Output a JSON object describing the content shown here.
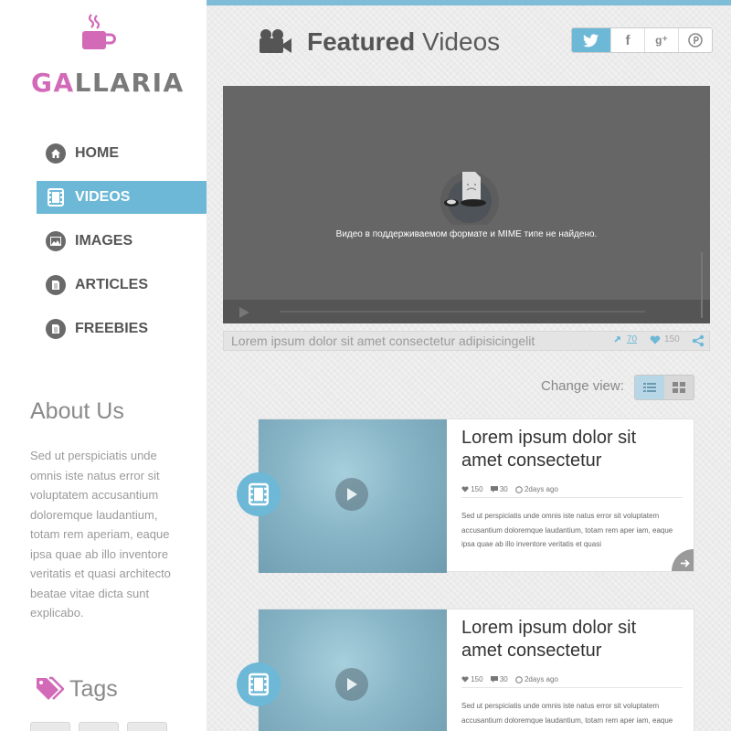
{
  "brand": {
    "logo_accent": "GA",
    "logo_rest": "LLARIA",
    "accent_color": "#d26ab8",
    "primary_color": "#6cb8d6"
  },
  "nav": {
    "items": [
      {
        "label": "HOME",
        "icon": "home-icon"
      },
      {
        "label": "VIDEOS",
        "icon": "film-icon"
      },
      {
        "label": "IMAGES",
        "icon": "image-icon"
      },
      {
        "label": "ARTICLES",
        "icon": "document-icon"
      },
      {
        "label": "FREEBIES",
        "icon": "document-icon"
      }
    ],
    "active": "VIDEOS"
  },
  "about": {
    "title": "About Us",
    "text": "Sed ut perspiciatis unde omnis iste natus error sit voluptatem accusantium doloremque laudantium, totam rem aperiam, eaque ipsa quae ab illo inventore veritatis et quasi architecto beatae vitae dicta sunt explicabo."
  },
  "tags": {
    "title": "Tags"
  },
  "header": {
    "title_bold": "Featured",
    "title_rest": " Videos"
  },
  "social": [
    "twitter-icon",
    "facebook-icon",
    "google-plus-icon",
    "pinterest-icon"
  ],
  "social_glyphs": {
    "facebook": "f",
    "google": "g⁺",
    "pinterest": "℗"
  },
  "player": {
    "message": "Видео в поддерживаемом формате и MIME типе не найдено.",
    "caption": "Lorem ipsum dolor sit amet consectetur adipisicingelit",
    "links": "70",
    "likes": "150"
  },
  "change_view": {
    "label": "Change view:",
    "options": [
      "list-view-icon",
      "grid-view-icon"
    ],
    "selected": "list-view-icon"
  },
  "videos": [
    {
      "title": "Lorem ipsum dolor sit amet consectetur",
      "likes": "150",
      "comments": "30",
      "date": "2days ago",
      "text": "Sed ut perspiciatis unde omnis iste natus error sit voluptatem accusantium doloremque laudantium, totam rem aper iam, eaque ipsa quae ab illo inventore veritatis et quasi"
    },
    {
      "title": "Lorem ipsum dolor sit amet consectetur",
      "likes": "150",
      "comments": "30",
      "date": "2days ago",
      "text": "Sed ut perspiciatis unde omnis iste natus error sit voluptatem accusantium doloremque laudantium, totam rem aper iam, eaque ipsa quae ab illo inventore veritatis et quasi"
    }
  ]
}
